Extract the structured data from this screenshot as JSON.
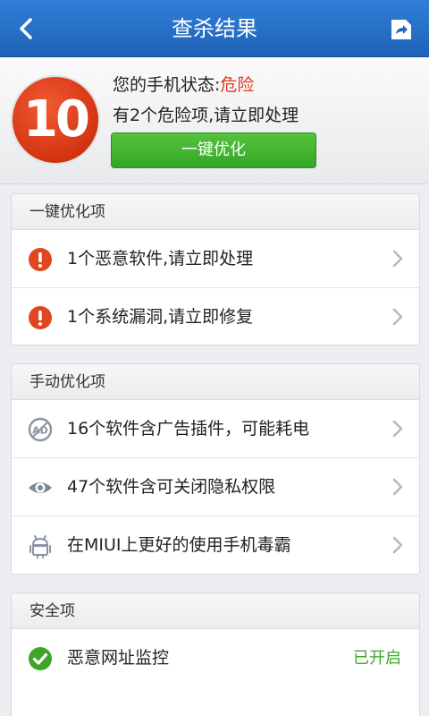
{
  "topbar": {
    "title": "查杀结果",
    "back_icon": "chevron-left-icon",
    "share_icon": "share-icon"
  },
  "header": {
    "score": "10",
    "status_prefix": "您的手机状态:",
    "status_value": "危险",
    "summary": "有2个危险项,请立即处理",
    "optimize_button": "一键优化"
  },
  "sections": [
    {
      "title": "一键优化项",
      "items": [
        {
          "icon": "warning-icon",
          "label": "1个恶意软件,请立即处理"
        },
        {
          "icon": "warning-icon",
          "label": "1个系统漏洞,请立即修复"
        }
      ]
    },
    {
      "title": "手动优化项",
      "items": [
        {
          "icon": "ad-icon",
          "label": "16个软件含广告插件，可能耗电"
        },
        {
          "icon": "eye-icon",
          "label": "47个软件含可关闭隐私权限"
        },
        {
          "icon": "android-icon",
          "label": "在MIUI上更好的使用手机毒霸"
        }
      ]
    },
    {
      "title": "安全项",
      "items": [
        {
          "icon": "check-icon",
          "label": "恶意网址监控",
          "state": "已开启"
        }
      ]
    }
  ],
  "colors": {
    "accent_blue": "#2f7fd6",
    "danger_red": "#e03a1e",
    "success_green": "#3ea52a"
  }
}
